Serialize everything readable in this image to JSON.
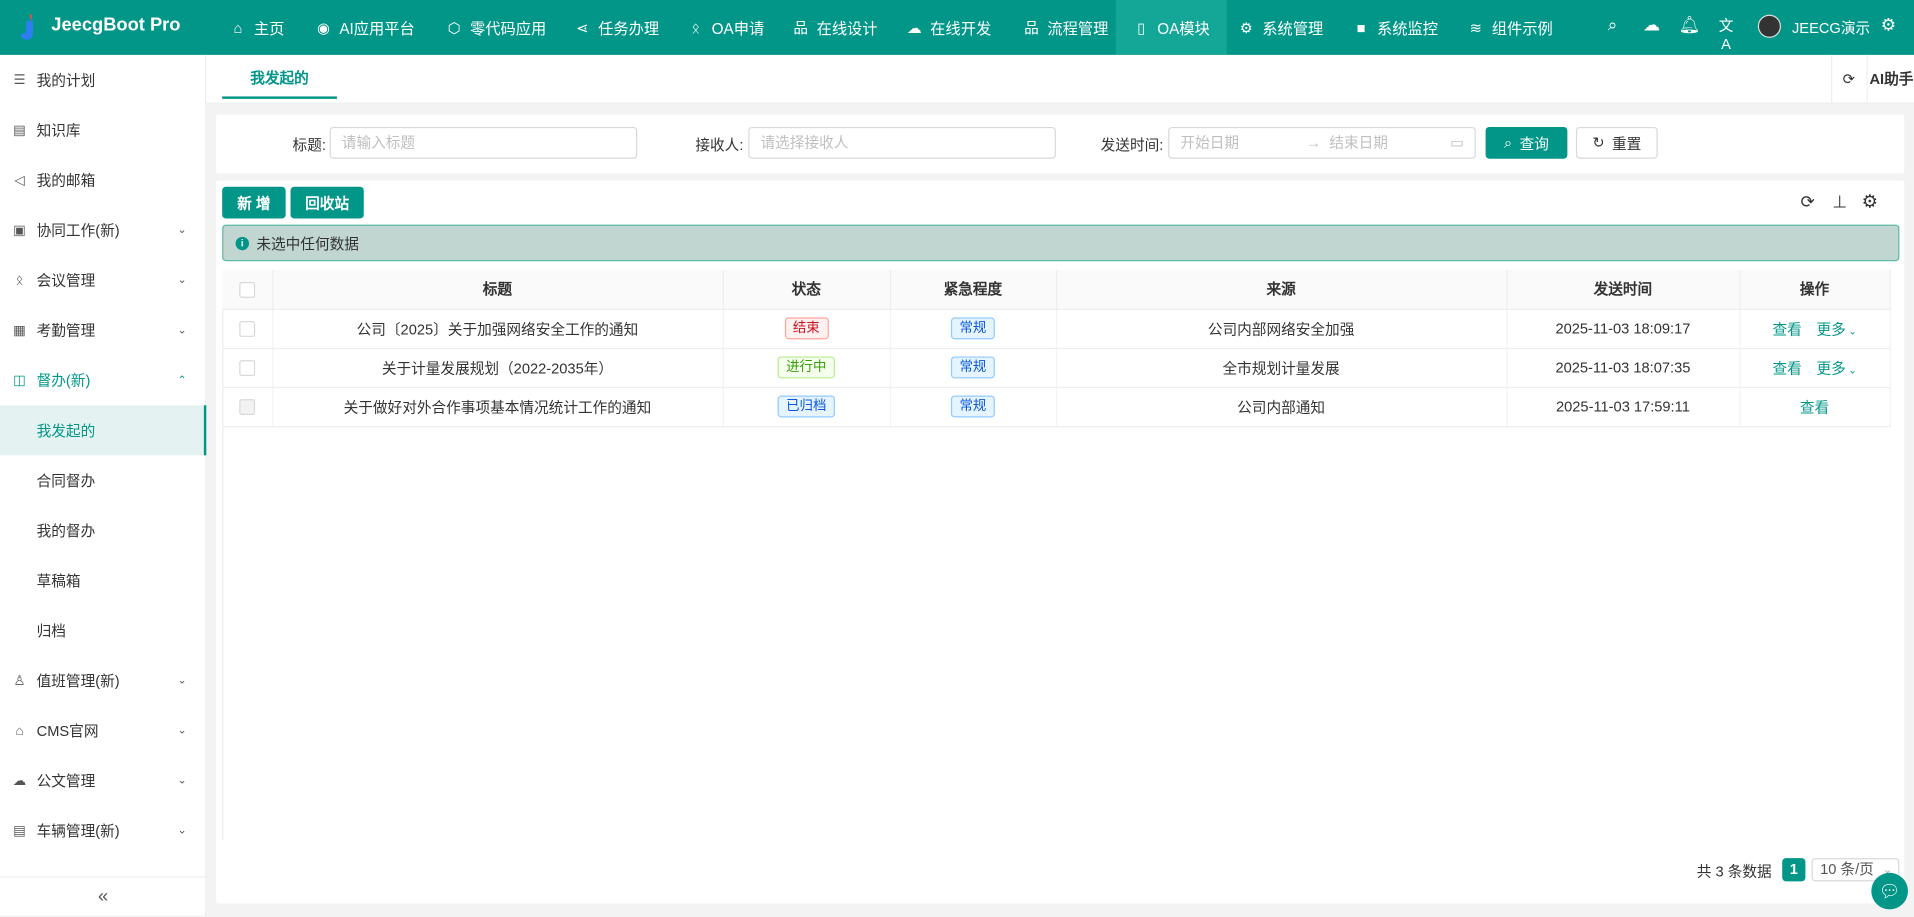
{
  "header": {
    "brand": "JeecgBoot Pro",
    "nav": [
      {
        "label": "主页",
        "icon": "home-icon",
        "glyph": "⌂"
      },
      {
        "label": "AI应用平台",
        "icon": "ai-icon",
        "glyph": "◉"
      },
      {
        "label": "零代码应用",
        "icon": "cube-icon",
        "glyph": "⬡"
      },
      {
        "label": "任务办理",
        "icon": "share-icon",
        "glyph": "⋖"
      },
      {
        "label": "OA申请",
        "icon": "person-icon",
        "glyph": "ᛟ"
      },
      {
        "label": "在线设计",
        "icon": "sitemap-icon",
        "glyph": "品"
      },
      {
        "label": "在线开发",
        "icon": "cloud-icon",
        "glyph": "☁"
      },
      {
        "label": "流程管理",
        "icon": "sitemap-icon",
        "glyph": "品"
      },
      {
        "label": "OA模块",
        "icon": "phone-icon",
        "glyph": "▯"
      },
      {
        "label": "系统管理",
        "icon": "gear-icon",
        "glyph": "⚙"
      },
      {
        "label": "系统监控",
        "icon": "camera-icon",
        "glyph": "■"
      },
      {
        "label": "组件示例",
        "icon": "layers-icon",
        "glyph": "≋"
      }
    ],
    "active_nav": "OA模块",
    "user": "JEECG演示"
  },
  "sidebar": {
    "items": [
      {
        "label": "我的计划",
        "glyph": "☰"
      },
      {
        "label": "知识库",
        "glyph": "▤"
      },
      {
        "label": "我的邮箱",
        "glyph": "◁"
      },
      {
        "label": "协同工作(新)",
        "glyph": "▣",
        "chevron": "⌄"
      },
      {
        "label": "会议管理",
        "glyph": "ᛟ",
        "chevron": "⌄"
      },
      {
        "label": "考勤管理",
        "glyph": "▦",
        "chevron": "⌄"
      },
      {
        "label": "督办(新)",
        "glyph": "◫",
        "chevron": "⌃"
      }
    ],
    "sub": [
      "我发起的",
      "合同督办",
      "我的督办",
      "草稿箱",
      "归档"
    ],
    "items2": [
      {
        "label": "值班管理(新)",
        "glyph": "♙",
        "chevron": "⌄"
      },
      {
        "label": "CMS官网",
        "glyph": "⌂",
        "chevron": "⌄"
      },
      {
        "label": "公文管理",
        "glyph": "☁",
        "chevron": "⌄"
      },
      {
        "label": "车辆管理(新)",
        "glyph": "▤",
        "chevron": "⌄"
      }
    ],
    "collapse": "«"
  },
  "tabs": {
    "active": "我发起的",
    "ai": "AI助手"
  },
  "search": {
    "title_label": "标题:",
    "title_ph": "请输入标题",
    "recv_label": "接收人:",
    "recv_ph": "请选择接收人",
    "time_label": "发送时间:",
    "start_ph": "开始日期",
    "end_ph": "结束日期",
    "query": "查询",
    "reset": "重置"
  },
  "toolbar": {
    "add": "新 增",
    "recycle": "回收站"
  },
  "alert": "未选中任何数据",
  "table": {
    "columns": [
      "标题",
      "状态",
      "紧急程度",
      "来源",
      "发送时间",
      "操作"
    ],
    "rows": [
      {
        "title": "公司〔2025〕关于加强网络安全工作的通知",
        "status": "结束",
        "status_color": "red",
        "urgency": "常规",
        "source": "公司内部网络安全加强",
        "time": "2025-11-03 18:09:17",
        "actions": [
          "查看",
          "更多"
        ]
      },
      {
        "title": "关于计量发展规划（2022-2035年）",
        "status": "进行中",
        "status_color": "green",
        "urgency": "常规",
        "source": "全市规划计量发展",
        "time": "2025-11-03 18:07:35",
        "actions": [
          "查看",
          "更多"
        ]
      },
      {
        "title": "关于做好对外合作事项基本情况统计工作的通知",
        "status": "已归档",
        "status_color": "blue",
        "urgency": "常规",
        "source": "公司内部通知",
        "time": "2025-11-03 17:59:11",
        "actions": [
          "查看"
        ]
      }
    ]
  },
  "pagination": {
    "total": "共 3 条数据",
    "page": "1",
    "size": "10 条/页"
  },
  "colors": {
    "primary": "#029688"
  }
}
